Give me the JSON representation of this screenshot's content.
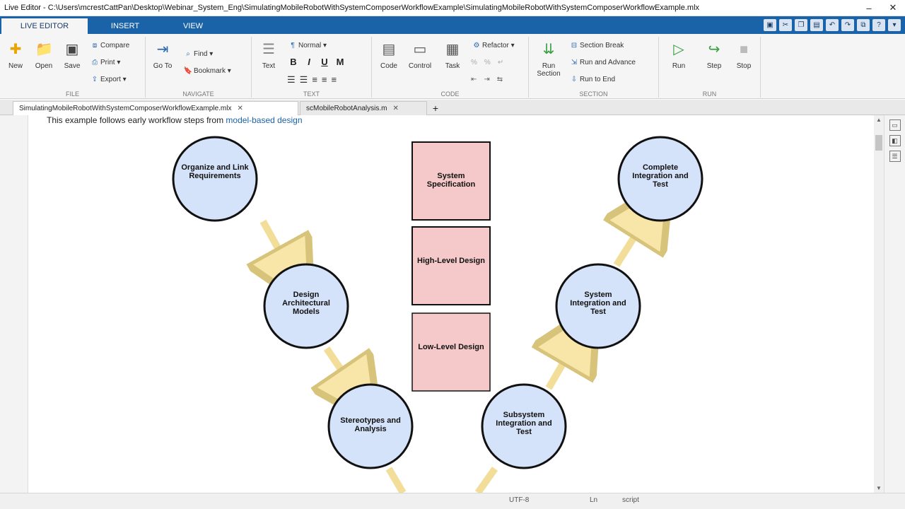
{
  "window": {
    "title": "Live Editor - C:\\Users\\mcrestCattPan\\Desktop\\Webinar_System_Eng\\SimulatingMobileRobotWithSystemComposerWorkflowExample\\SimulatingMobileRobotWithSystemComposerWorkflowExample.mlx",
    "minimize": "–",
    "close": "✕"
  },
  "ribbon_tabs": [
    {
      "label": "LIVE EDITOR"
    },
    {
      "label": "INSERT"
    },
    {
      "label": "VIEW"
    }
  ],
  "groups": {
    "file": {
      "label": "FILE",
      "new": "New",
      "open": "Open",
      "save": "Save",
      "compare": "Compare",
      "print": "Print",
      "export": "Export"
    },
    "navigate": {
      "label": "NAVIGATE",
      "goto": "Go To",
      "find": "Find",
      "bookmark": "Bookmark"
    },
    "text": {
      "label": "TEXT",
      "text_button": "Text",
      "style": "Normal",
      "bold": "B",
      "italic": "I",
      "underline": "U",
      "mono": "M"
    },
    "code": {
      "label": "CODE",
      "code": "Code",
      "control": "Control",
      "task": "Task",
      "refactor": "Refactor"
    },
    "section": {
      "label": "SECTION",
      "run_section": "Run Section",
      "section_break": "Section Break",
      "run_and_advance": "Run and Advance",
      "run_to_end": "Run to End"
    },
    "run": {
      "label": "RUN",
      "run": "Run",
      "step": "Step",
      "stop": "Stop"
    }
  },
  "doc_tabs": [
    {
      "label": "SimulatingMobileRobotWithSystemComposerWorkflowExample.mlx",
      "close": "✕"
    },
    {
      "label": "scMobileRobotAnalysis.m",
      "close": "✕"
    }
  ],
  "new_tab": "+",
  "intro": {
    "text": "This example follows early workflow steps from ",
    "link": "model-based design"
  },
  "diagram": {
    "left_circles": [
      {
        "label": "Organize and Link Requirements"
      },
      {
        "label": "Design Architectural Models"
      },
      {
        "label": "Stereotypes and Analysis"
      }
    ],
    "right_circles": [
      {
        "label": "Subsystem Integration and Test"
      },
      {
        "label": "System Integration and Test"
      },
      {
        "label": "Complete Integration and Test"
      }
    ],
    "boxes": [
      {
        "label": "System Specification"
      },
      {
        "label": "High-Level Design"
      },
      {
        "label": "Low-Level Design"
      }
    ],
    "colors": {
      "circle_fill": "#d5e3fa",
      "box_fill": "#f5c9c9",
      "arrow_fill": "#f7e6a7",
      "arrow_stroke": "#d8c37a"
    }
  },
  "status": {
    "encoding": "UTF-8",
    "line": "Ln",
    "mode": "script"
  }
}
